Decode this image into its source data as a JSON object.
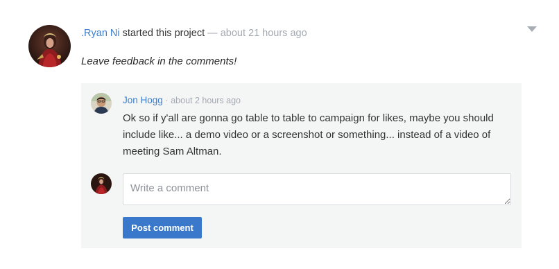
{
  "activity": {
    "author": ".Ryan Ni",
    "action": "started this project",
    "separator": "—",
    "timestamp": "about 21 hours ago",
    "project_text": "Leave feedback in the comments!"
  },
  "comments": [
    {
      "author": "Jon Hogg",
      "separator": "·",
      "timestamp": "about 2 hours ago",
      "body": "Ok so if y'all are gonna go table to table to campaign for likes, maybe you should include like... a demo video or a screenshot or something... instead of a video of meeting Sam Altman."
    }
  ],
  "new_comment": {
    "placeholder": "Write a comment",
    "value": "",
    "submit_label": "Post comment"
  },
  "colors": {
    "link": "#3d7ecb",
    "button": "#3a78cc",
    "timestamp": "#a3a9b1",
    "panel": "#f4f5f5"
  },
  "icons": {
    "menu": "caret-down-icon"
  }
}
